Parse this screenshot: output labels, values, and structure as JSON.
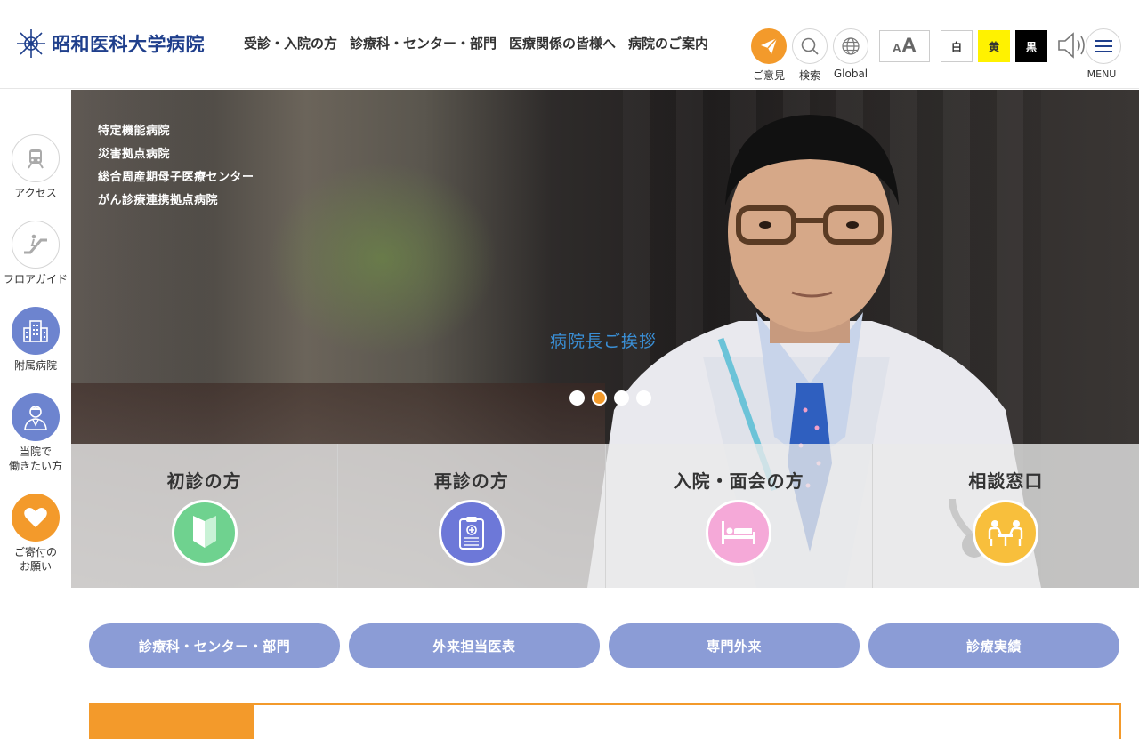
{
  "header": {
    "logo_text": "昭和医科大学病院",
    "nav": [
      "受診・入院の方",
      "診療科・センター・部門",
      "医療関係の皆様へ",
      "病院のご案内"
    ],
    "opinion_label": "ご意見",
    "search_label": "検索",
    "global_label": "Global",
    "color_white": "白",
    "color_yellow": "黄",
    "color_black": "黒",
    "menu_label": "MENU",
    "accent": "#f39a2b",
    "brand": "#1f3f8c"
  },
  "sidenav": [
    {
      "label": "アクセス",
      "icon": "train-icon"
    },
    {
      "label": "フロアガイド",
      "icon": "escalator-icon"
    },
    {
      "label": "附属病院",
      "icon": "building-icon"
    },
    {
      "label": "当院で\n働きたい方",
      "icon": "doctor-icon"
    },
    {
      "label": "ご寄付の\nお願い",
      "icon": "heart-icon"
    }
  ],
  "hero": {
    "tags": [
      "特定機能病院",
      "災害拠点病院",
      "総合周産期母子医療センター",
      "がん診療連携拠点病院"
    ],
    "greeting": "病院長ご挨拶",
    "slides": 4,
    "active_slide": 2
  },
  "quick": [
    {
      "title": "初診の方",
      "color": "#6fd28f",
      "icon": "beginner-mark-icon"
    },
    {
      "title": "再診の方",
      "color": "#6d78d8",
      "icon": "clipboard-icon"
    },
    {
      "title": "入院・面会の方",
      "color": "#f5a9d8",
      "icon": "bed-icon"
    },
    {
      "title": "相談窓口",
      "color": "#f8bf3c",
      "icon": "consultation-icon"
    }
  ],
  "pills": [
    "診療科・センター・部門",
    "外来担当医表",
    "専門外来",
    "診療実績"
  ]
}
